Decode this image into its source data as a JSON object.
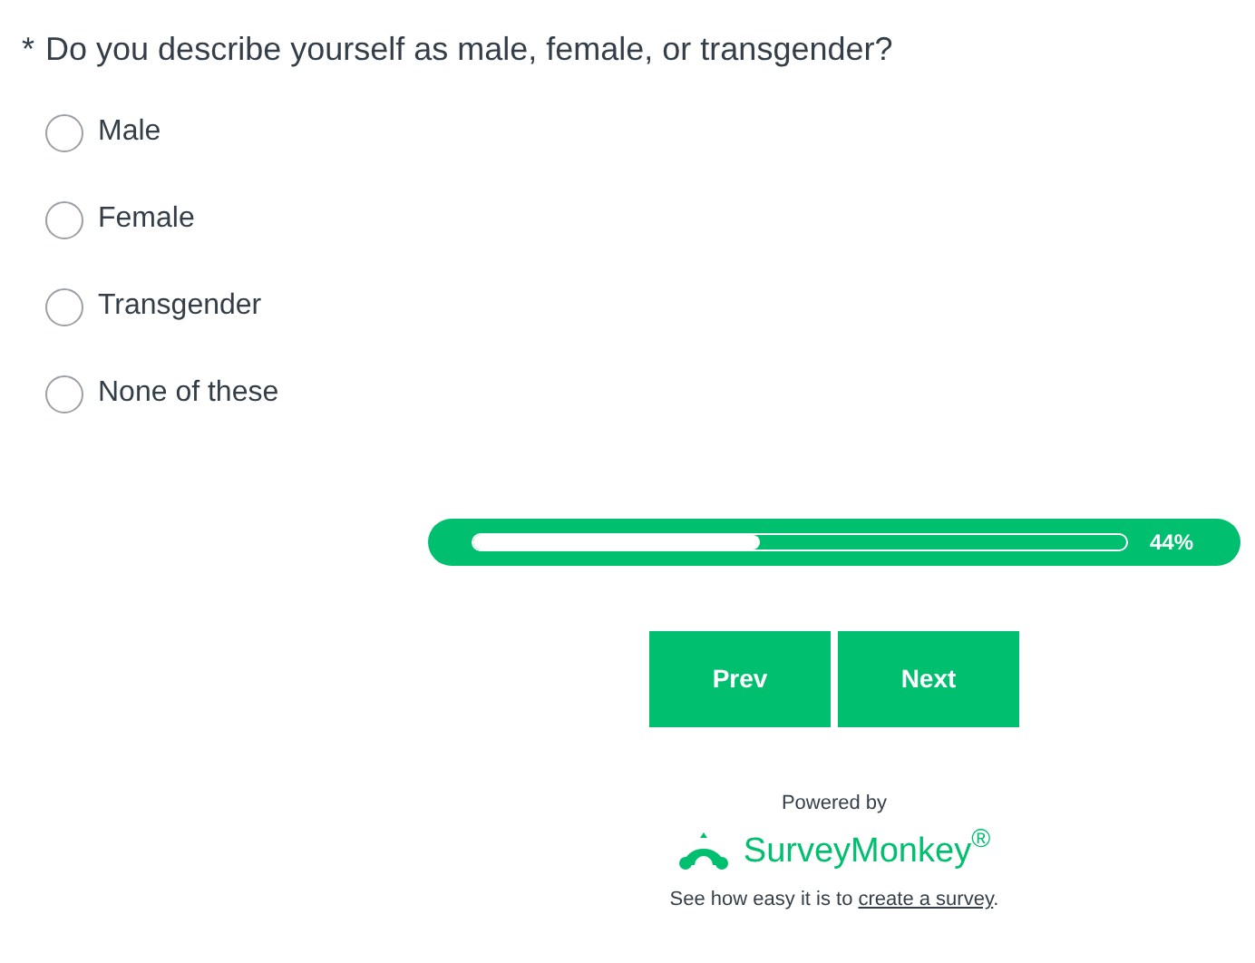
{
  "question": {
    "required_mark": "*",
    "text": "Do you describe yourself as male, female, or transgender?"
  },
  "options": [
    {
      "label": "Male",
      "selected": false
    },
    {
      "label": "Female",
      "selected": false
    },
    {
      "label": "Transgender",
      "selected": false
    },
    {
      "label": "None of these",
      "selected": false
    }
  ],
  "progress": {
    "level": 0.44,
    "reading": "44%"
  },
  "buttons": [
    "Prev",
    "Next"
  ],
  "footer": {
    "powered_by": "Powered by",
    "logo_text": "SurveyMonkey$^{®}$",
    "sentence": "See how easy it is to ",
    "link": "create a survey",
    "end": "."
  }
}
